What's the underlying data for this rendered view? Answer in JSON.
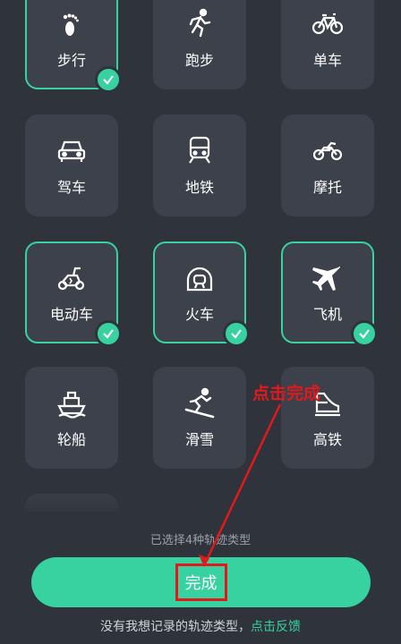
{
  "tiles": {
    "walk": {
      "label": "步行",
      "selected": true
    },
    "run": {
      "label": "跑步",
      "selected": false
    },
    "bike": {
      "label": "单车",
      "selected": false
    },
    "drive": {
      "label": "驾车",
      "selected": false
    },
    "subway": {
      "label": "地铁",
      "selected": false
    },
    "motorcycle": {
      "label": "摩托",
      "selected": false
    },
    "ebike": {
      "label": "电动车",
      "selected": true
    },
    "train": {
      "label": "火车",
      "selected": true
    },
    "plane": {
      "label": "飞机",
      "selected": true
    },
    "ship": {
      "label": "轮船",
      "selected": false
    },
    "ski": {
      "label": "滑雪",
      "selected": false
    },
    "highspeed": {
      "label": "高铁",
      "selected": false
    }
  },
  "status": {
    "selected_count_text": "已选择4种轨迹类型"
  },
  "done_button": {
    "label": "完成"
  },
  "footer": {
    "text": "没有我想记录的轨迹类型，",
    "link": "点击反馈"
  },
  "annotation": {
    "text": "点击完成"
  },
  "colors": {
    "accent": "#37d2a0",
    "background": "#2f333b",
    "tile": "#3c414b",
    "annotation": "#e2191c"
  }
}
